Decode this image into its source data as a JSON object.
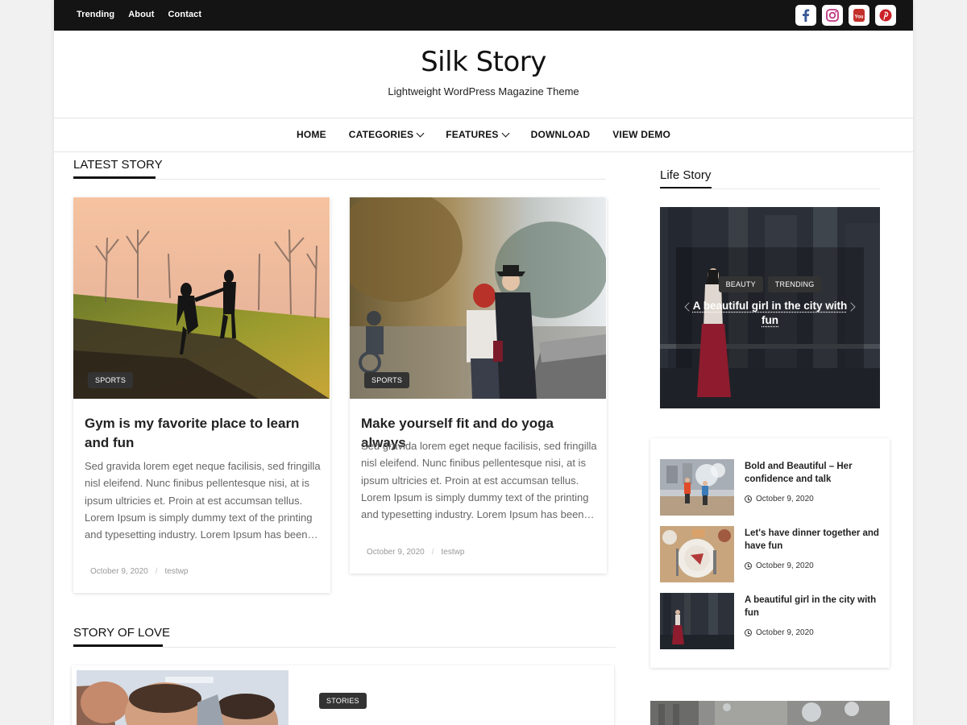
{
  "topbar": {
    "links": [
      "Trending",
      "About",
      "Contact"
    ],
    "social_icons": [
      "facebook-icon",
      "instagram-icon",
      "youtube-icon",
      "pinterest-icon"
    ]
  },
  "header": {
    "title": "Silk Story",
    "tagline": "Lightweight WordPress Magazine Theme"
  },
  "nav": {
    "items": [
      {
        "label": "HOME",
        "dropdown": false
      },
      {
        "label": "CATEGORIES",
        "dropdown": true
      },
      {
        "label": "FEATURES",
        "dropdown": true
      },
      {
        "label": "DOWNLOAD",
        "dropdown": false
      },
      {
        "label": "VIEW DEMO",
        "dropdown": false
      }
    ]
  },
  "latest": {
    "heading": "LATEST STORY",
    "posts": [
      {
        "tag": "SPORTS",
        "title": "Gym is my favorite place to learn and fun",
        "excerpt": "Sed gravida lorem eget neque facilisis, sed fringilla nisl eleifend. Nunc finibus pellentesque nisi, at is ipsum ultricies et. Proin at est accumsan tellus. Lorem Ipsum is simply dummy text of the printing and typesetting industry. Lorem Ipsum has been…",
        "date": "October 9, 2020",
        "author": "testwp"
      },
      {
        "tag": "SPORTS",
        "title": "Make yourself fit and do yoga always",
        "excerpt": "Sed gravida lorem eget neque facilisis, sed fringilla nisl eleifend. Nunc finibus pellentesque nisi, at is ipsum ultricies et. Proin at est accumsan tellus. Lorem Ipsum is simply dummy text of the printing and typesetting industry. Lorem Ipsum has been…",
        "date": "October 9, 2020",
        "author": "testwp"
      }
    ]
  },
  "love": {
    "heading": "STORY OF LOVE",
    "tag": "STORIES"
  },
  "sidebar": {
    "heading": "Life Story",
    "slider": {
      "tags": [
        "BEAUTY",
        "TRENDING"
      ],
      "title": "A beautiful girl in the city with fun"
    },
    "posts": [
      {
        "title": "Bold and Beautiful – Her confidence and talk",
        "date": "October 9, 2020"
      },
      {
        "title": "Let's have dinner together and have fun",
        "date": "October 9, 2020"
      },
      {
        "title": "A beautiful girl in the city with fun",
        "date": "October 9, 2020"
      }
    ]
  }
}
